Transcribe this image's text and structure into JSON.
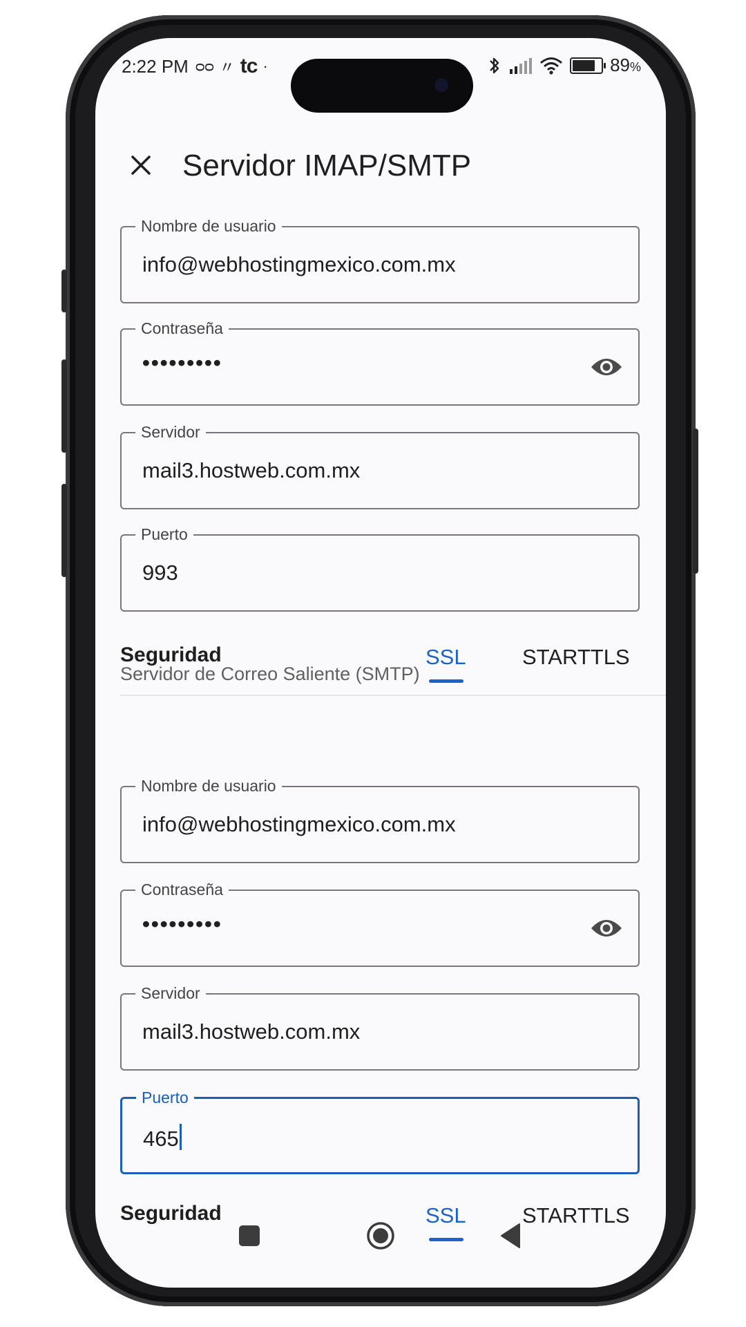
{
  "status_bar": {
    "time": "2:22 PM",
    "carrier_logo": "tc",
    "battery_percent": "89",
    "battery_unit": "%",
    "battery_level": 0.89,
    "icons": [
      "voicemail-icon",
      "brand-icon",
      "bluetooth-icon",
      "signal-icon",
      "wifi-icon",
      "battery-icon"
    ]
  },
  "app_bar": {
    "title": "Servidor IMAP/SMTP",
    "close_icon": "close-icon"
  },
  "incoming": {
    "username": {
      "label": "Nombre de usuario",
      "value": "info@webhostingmexico.com.mx"
    },
    "password": {
      "label": "Contraseña",
      "value": "•••••••••"
    },
    "server": {
      "label": "Servidor",
      "value": "mail3.hostweb.com.mx"
    },
    "port": {
      "label": "Puerto",
      "value": "993"
    },
    "security": {
      "label": "Seguridad",
      "options": [
        "SSL",
        "STARTTLS"
      ],
      "selected": "SSL"
    }
  },
  "outgoing": {
    "section_title": "Servidor de Correo Saliente (SMTP)",
    "username": {
      "label": "Nombre de usuario",
      "value": "info@webhostingmexico.com.mx"
    },
    "password": {
      "label": "Contraseña",
      "value": "•••••••••"
    },
    "server": {
      "label": "Servidor",
      "value": "mail3.hostweb.com.mx"
    },
    "port": {
      "label": "Puerto",
      "value": "465"
    },
    "security": {
      "label": "Seguridad",
      "options": [
        "SSL",
        "STARTTLS"
      ],
      "selected": "SSL"
    }
  },
  "colors": {
    "accent": "#1a63c8",
    "focus_border": "#1a5fb4",
    "outline": "#79747e",
    "background": "#fafafc"
  }
}
